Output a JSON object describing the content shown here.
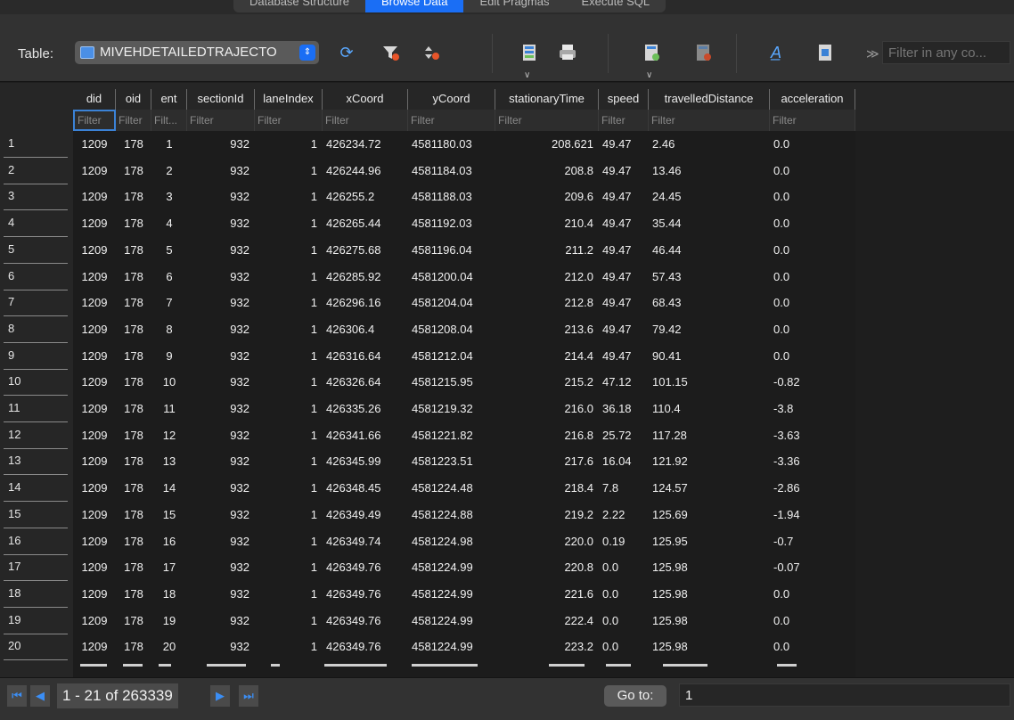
{
  "tabs": [
    "Database Structure",
    "Browse Data",
    "Edit Pragmas",
    "Execute SQL"
  ],
  "toolbar": {
    "table_label": "Table:",
    "table_value": "MIVEHDETAILEDTRAJECTO",
    "filter_any_placeholder": "Filter in any co..."
  },
  "grid": {
    "columns": [
      "did",
      "oid",
      "ent",
      "sectionId",
      "laneIndex",
      "xCoord",
      "yCoord",
      "stationaryTime",
      "speed",
      "travelledDistance",
      "acceleration"
    ],
    "filters": [
      "Filter",
      "Filter",
      "Filt...",
      "Filter",
      "Filter",
      "Filter",
      "Filter",
      "Filter",
      "Filter",
      "Filter",
      "Filter"
    ],
    "rows": [
      [
        "1",
        "1209",
        "178",
        "1",
        "932",
        "1",
        "426234.72",
        "4581180.03",
        "208.621",
        "49.47",
        "2.46",
        "0.0"
      ],
      [
        "2",
        "1209",
        "178",
        "2",
        "932",
        "1",
        "426244.96",
        "4581184.03",
        "208.8",
        "49.47",
        "13.46",
        "0.0"
      ],
      [
        "3",
        "1209",
        "178",
        "3",
        "932",
        "1",
        "426255.2",
        "4581188.03",
        "209.6",
        "49.47",
        "24.45",
        "0.0"
      ],
      [
        "4",
        "1209",
        "178",
        "4",
        "932",
        "1",
        "426265.44",
        "4581192.03",
        "210.4",
        "49.47",
        "35.44",
        "0.0"
      ],
      [
        "5",
        "1209",
        "178",
        "5",
        "932",
        "1",
        "426275.68",
        "4581196.04",
        "211.2",
        "49.47",
        "46.44",
        "0.0"
      ],
      [
        "6",
        "1209",
        "178",
        "6",
        "932",
        "1",
        "426285.92",
        "4581200.04",
        "212.0",
        "49.47",
        "57.43",
        "0.0"
      ],
      [
        "7",
        "1209",
        "178",
        "7",
        "932",
        "1",
        "426296.16",
        "4581204.04",
        "212.8",
        "49.47",
        "68.43",
        "0.0"
      ],
      [
        "8",
        "1209",
        "178",
        "8",
        "932",
        "1",
        "426306.4",
        "4581208.04",
        "213.6",
        "49.47",
        "79.42",
        "0.0"
      ],
      [
        "9",
        "1209",
        "178",
        "9",
        "932",
        "1",
        "426316.64",
        "4581212.04",
        "214.4",
        "49.47",
        "90.41",
        "0.0"
      ],
      [
        "10",
        "1209",
        "178",
        "10",
        "932",
        "1",
        "426326.64",
        "4581215.95",
        "215.2",
        "47.12",
        "101.15",
        "-0.82"
      ],
      [
        "11",
        "1209",
        "178",
        "11",
        "932",
        "1",
        "426335.26",
        "4581219.32",
        "216.0",
        "36.18",
        "110.4",
        "-3.8"
      ],
      [
        "12",
        "1209",
        "178",
        "12",
        "932",
        "1",
        "426341.66",
        "4581221.82",
        "216.8",
        "25.72",
        "117.28",
        "-3.63"
      ],
      [
        "13",
        "1209",
        "178",
        "13",
        "932",
        "1",
        "426345.99",
        "4581223.51",
        "217.6",
        "16.04",
        "121.92",
        "-3.36"
      ],
      [
        "14",
        "1209",
        "178",
        "14",
        "932",
        "1",
        "426348.45",
        "4581224.48",
        "218.4",
        "7.8",
        "124.57",
        "-2.86"
      ],
      [
        "15",
        "1209",
        "178",
        "15",
        "932",
        "1",
        "426349.49",
        "4581224.88",
        "219.2",
        "2.22",
        "125.69",
        "-1.94"
      ],
      [
        "16",
        "1209",
        "178",
        "16",
        "932",
        "1",
        "426349.74",
        "4581224.98",
        "220.0",
        "0.19",
        "125.95",
        "-0.7"
      ],
      [
        "17",
        "1209",
        "178",
        "17",
        "932",
        "1",
        "426349.76",
        "4581224.99",
        "220.8",
        "0.0",
        "125.98",
        "-0.07"
      ],
      [
        "18",
        "1209",
        "178",
        "18",
        "932",
        "1",
        "426349.76",
        "4581224.99",
        "221.6",
        "0.0",
        "125.98",
        "0.0"
      ],
      [
        "19",
        "1209",
        "178",
        "19",
        "932",
        "1",
        "426349.76",
        "4581224.99",
        "222.4",
        "0.0",
        "125.98",
        "0.0"
      ],
      [
        "20",
        "1209",
        "178",
        "20",
        "932",
        "1",
        "426349.76",
        "4581224.99",
        "223.2",
        "0.0",
        "125.98",
        "0.0"
      ]
    ]
  },
  "pager": {
    "count_text": "1 - 21 of 263339",
    "goto_label": "Go to:",
    "goto_value": "1"
  },
  "colors": {
    "accent": "#1a6ef5",
    "background": "#1e1e1e",
    "toolbar": "#323232",
    "nav_icon": "#3b8ef5"
  },
  "icons": [
    "table-icon",
    "refresh-icon",
    "clear-filters-icon",
    "sort-icon",
    "save-table-icon",
    "print-icon",
    "insert-record-icon",
    "delete-record-icon",
    "set-encoding-icon",
    "export-icon",
    "more-icon",
    "first-page-icon",
    "prev-page-icon",
    "next-page-icon",
    "last-page-icon"
  ]
}
